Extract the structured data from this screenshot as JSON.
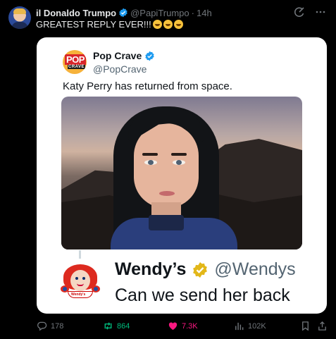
{
  "post": {
    "author_name": "il Donaldo Trumpo",
    "author_handle": "@PapiTrumpo",
    "separator": "·",
    "time": "14h",
    "text": "GREATEST REPLY EVER!!!",
    "emoji_count": 3,
    "emoji_name": "rolling-on-floor-laughing-emoji"
  },
  "quoted_post": {
    "author_name": "Pop Crave",
    "author_handle": "@PopCrave",
    "text": "Katy Perry has returned from space.",
    "logo_text_top": "POP",
    "logo_text_bottom": "CRAVE"
  },
  "reply": {
    "author_name": "Wendy’s",
    "author_handle": "@Wendys",
    "text": "Can we send her back",
    "logo_text": "Wendy's"
  },
  "actions": {
    "replies": "178",
    "reposts": "864",
    "likes": "7.3K",
    "views": "102K"
  },
  "colors": {
    "background": "#000000",
    "verified_blue": "#1d9bf0",
    "verified_gold": "#e2b719",
    "repost_green": "#00ba7c",
    "like_pink": "#f91880"
  },
  "icons": {
    "grok": "grok-icon",
    "more": "more-icon",
    "reply": "reply-icon",
    "repost": "repost-icon",
    "like": "heart-icon",
    "views": "views-icon",
    "bookmark": "bookmark-icon",
    "share": "share-icon"
  }
}
